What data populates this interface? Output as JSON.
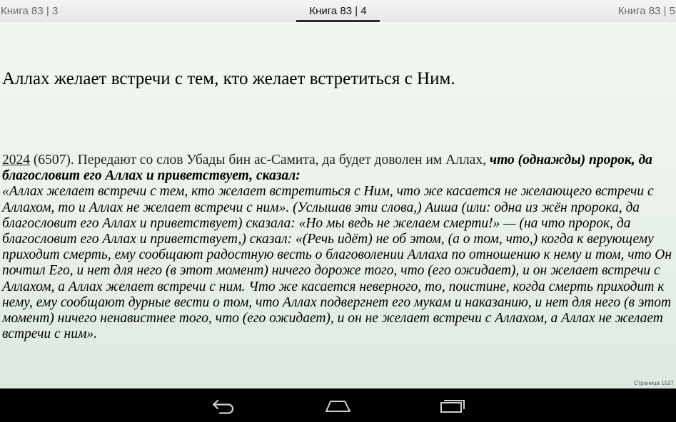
{
  "tabs": [
    {
      "label": "Книга 83 | 3"
    },
    {
      "label": "Книга 83 | 4",
      "active": true
    },
    {
      "label": "Книга 83 | 5"
    }
  ],
  "chapter_title": "Аллах желает встречи с тем, кто желает встретиться с Ним.",
  "hadith": {
    "number": "2024",
    "ref": " (6507).",
    "intro": " Передают со слов Убады бин ас-Самита, да будет доволен им Аллах, ",
    "lead_bold": "что (однажды) пророк, да благословит его Аллах и приветствует, сказал:",
    "body": "«Аллах желает встречи с тем, кто желает встретиться с Ним, что же касается не желающего встречи с Аллахом, то и Аллах не желает встречи с ним». (Услышав эти слова,) Аиша (или: одна из жён пророка, да благословит его Аллах и приветствует) сказала: «Но мы ведь не желаем смерти!» — (на что пророк, да благословит его Аллах и приветствует,) сказал: «(Речь идёт) не об этом, (а о том, что,) когда к верующему приходит смерть, ему сообщают радостную весть о благоволении Аллаха по отношению к нему и том, что Он почтил Его, и нет для него (в этот момент) ничего дороже того, что (его ожидает), и он желает встречи с Аллахом, а Аллах желает встречи с ним. Что же касается неверного, то, поистине, когда смерть приходит к нему, ему сообщают дурные вести о том, что Аллах подвергнет его мукам и наказанию, и нет для него (в этот момент) ничего ненавистнее того, что (его ожидает), и он не желает встречи с Аллахом, а Аллах не желает встречи с ним»."
  },
  "page_counter": "Страница 1527",
  "nav": {
    "back_icon": "back-icon",
    "home_icon": "home-icon",
    "recents_icon": "recents-icon"
  },
  "colors": {
    "background": "#eef5ee",
    "tab_indicator": "#2a2a2a",
    "navbar": "#000000"
  }
}
